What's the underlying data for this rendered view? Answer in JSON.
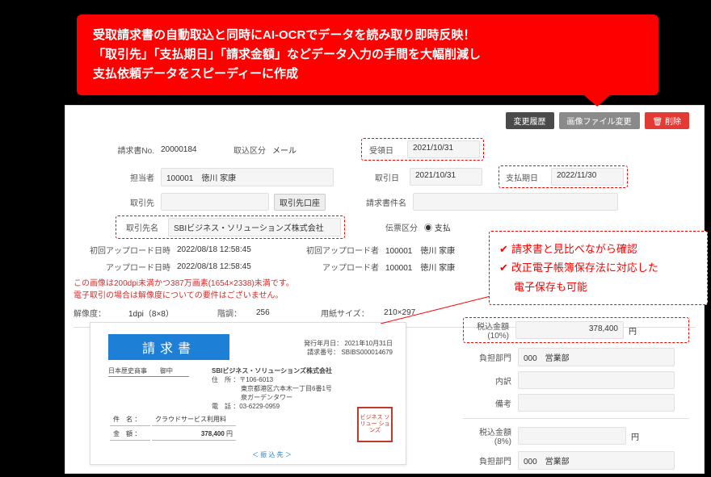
{
  "callout": {
    "line1": "受取請求書の自動取込と同時にAI-OCRでデータを読み取り即時反映！",
    "line2": "「取引先」「支払期日」「請求金額」などデータ入力の手間を大幅削減し",
    "line3": "支払依頼データをスピーディーに作成"
  },
  "toolbar": {
    "history": "変更履歴",
    "imagechange": "画像ファイル変更",
    "delete": "削除"
  },
  "labels": {
    "invoice_no": "請求書No.",
    "import_type": "取込区分",
    "person": "担当者",
    "partner": "取引先",
    "partner_account": "取引先口座",
    "partner_name": "取引先名",
    "recv_date": "受領日",
    "tx_date": "取引日",
    "pay_due": "支払期日",
    "title_name": "請求書件名",
    "slip_type": "伝票区分",
    "first_upload_time": "初回アップロード日時",
    "first_upload_user": "初回アップロード者",
    "upload_time": "アップロード日時",
    "upload_user": "アップロード者",
    "resolution": "解像度：",
    "depth": "階調：",
    "paper": "用紙サイズ：",
    "tax10": "税込金額\n(10%)",
    "dept": "負担部門",
    "detail": "内訳",
    "memo": "備考",
    "tax8": "税込金額\n(8%)",
    "yen": "円"
  },
  "values": {
    "invoice_no": "20000184",
    "import_type": "メール",
    "person": "100001　徳川 家康",
    "partner": "",
    "partner_name": "SBIビジネス・ソリューションズ株式会社",
    "recv_date": "2021/10/31",
    "tx_date": "2021/10/31",
    "pay_due": "2022/11/30",
    "title_name": "",
    "slip_radio": "支払",
    "first_upload_time": "2022/08/18 12:58:45",
    "first_upload_user": "100001　徳川 家康",
    "upload_time": "2022/08/18 12:58:45",
    "upload_user": "100001　徳川 家康",
    "warn1": "この画像は200dpi未満かつ387万画素(1654×2338)未満です。",
    "warn2": "電子取引の場合は解像度についての要件はございません。",
    "resolution": "1dpi（8×8）",
    "depth": "256",
    "paper": "210×297",
    "tax10": "378,400",
    "dept10": "000　営業部",
    "detail": "",
    "memo": "",
    "tax8": "",
    "dept8": "000　営業部"
  },
  "sidebox": {
    "l1": "請求書と見比べながら確認",
    "l2": "改正電子帳簿保存法に対応した",
    "l3": "電子保存も可能"
  },
  "invoice": {
    "heading": "請求書",
    "issue_lbl": "発行年月日：",
    "issue": "2021年10月31日",
    "no_lbl": "請求番号：",
    "no": "SBIBS000014679",
    "to": "日本歴史商事",
    "to_suffix": "御中",
    "from": "SBIビジネス・ソリューションズ株式会社",
    "addr_lbl": "住　所 ：",
    "zip": "〒106-6013",
    "addr1": "東京都港区六本木一丁目6番1号",
    "addr2": "泉ガーデンタワー",
    "tel_lbl": "電　話 ：",
    "tel": "03-6229-0959",
    "item_lbl": "件　名 ：",
    "item": "クラウドサービス利用料",
    "amt_lbl": "金　額 ：",
    "amt": "378,400",
    "amt_unit": "円",
    "transfer": "＜ 振 込 先 ＞",
    "stamp": "ビジネス\nソリュー\nションズ"
  }
}
